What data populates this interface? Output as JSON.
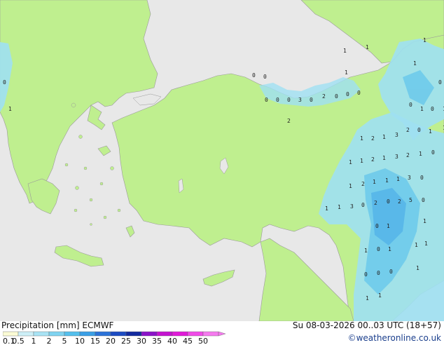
{
  "title": "Precipitation [mm]  ECMWF",
  "datetime": "Su 08-03-2026 00..03 UTC (18+57)",
  "credit": "©weatheronline.co.uk",
  "legend": {
    "ticks": [
      "0.1",
      "0.5",
      "1",
      "2",
      "5",
      "10",
      "15",
      "20",
      "25",
      "30",
      "35",
      "40",
      "45",
      "50"
    ],
    "colors": [
      "#fbfbd4",
      "#cdeff7",
      "#a8e3f4",
      "#7fd3f0",
      "#54bfec",
      "#3a9fe6",
      "#2b72d8",
      "#1c4bc2",
      "#122a9e",
      "#8a12c8",
      "#c412d0",
      "#e01ad8",
      "#f04ae8",
      "#f57aee"
    ]
  },
  "colors": {
    "land": "#bfef8f",
    "sea": "#e8e8e8",
    "border": "#9a9a9a",
    "precip": "#9fe0f2"
  },
  "rain_values": [
    "1",
    "0",
    "0",
    "0",
    "0",
    "0",
    "0",
    "2",
    "3",
    "0",
    "2",
    "0",
    "0",
    "0",
    "1",
    "1",
    "1",
    "1",
    "1",
    "0",
    "0",
    "1",
    "0",
    "1",
    "1",
    "2",
    "1",
    "3",
    "2",
    "0",
    "1",
    "1",
    "1",
    "1",
    "2",
    "1",
    "3",
    "2",
    "1",
    "0",
    "1",
    "2",
    "1",
    "1",
    "1",
    "3",
    "0",
    "1",
    "1",
    "3",
    "0",
    "2",
    "0",
    "2",
    "5",
    "0",
    "0",
    "1",
    "1",
    "1",
    "0",
    "1",
    "1",
    "1",
    "0",
    "0",
    "0",
    "1",
    "1",
    "1"
  ]
}
